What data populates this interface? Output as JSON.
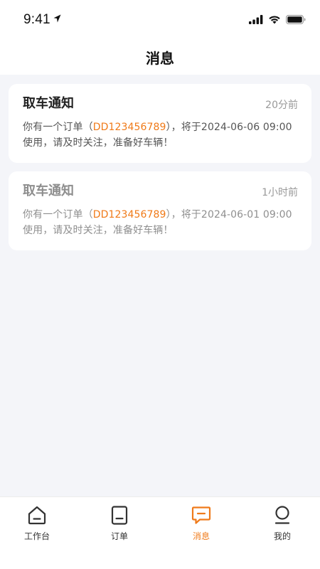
{
  "status_bar": {
    "time": "9:41"
  },
  "header": {
    "title": "消息"
  },
  "messages": [
    {
      "title": "取车通知",
      "time": "20分前",
      "text_before": "你有一个订单（",
      "order_id": "DD123456789",
      "text_after": "），将于2024-06-06 09:00使用，请及时关注，准备好车辆！",
      "read": false
    },
    {
      "title": "取车通知",
      "time": "1小时前",
      "text_before": "你有一个订单（",
      "order_id": "DD123456789",
      "text_after": "），将于2024-06-01 09:00使用，请及时关注，准备好车辆！",
      "read": true
    }
  ],
  "tabbar": {
    "items": [
      {
        "label": "工作台",
        "icon": "home-icon",
        "active": false
      },
      {
        "label": "订单",
        "icon": "order-icon",
        "active": false
      },
      {
        "label": "消息",
        "icon": "message-icon",
        "active": true
      },
      {
        "label": "我的",
        "icon": "profile-icon",
        "active": false
      }
    ]
  },
  "colors": {
    "accent": "#ef7a1a",
    "background": "#f4f5f9"
  }
}
